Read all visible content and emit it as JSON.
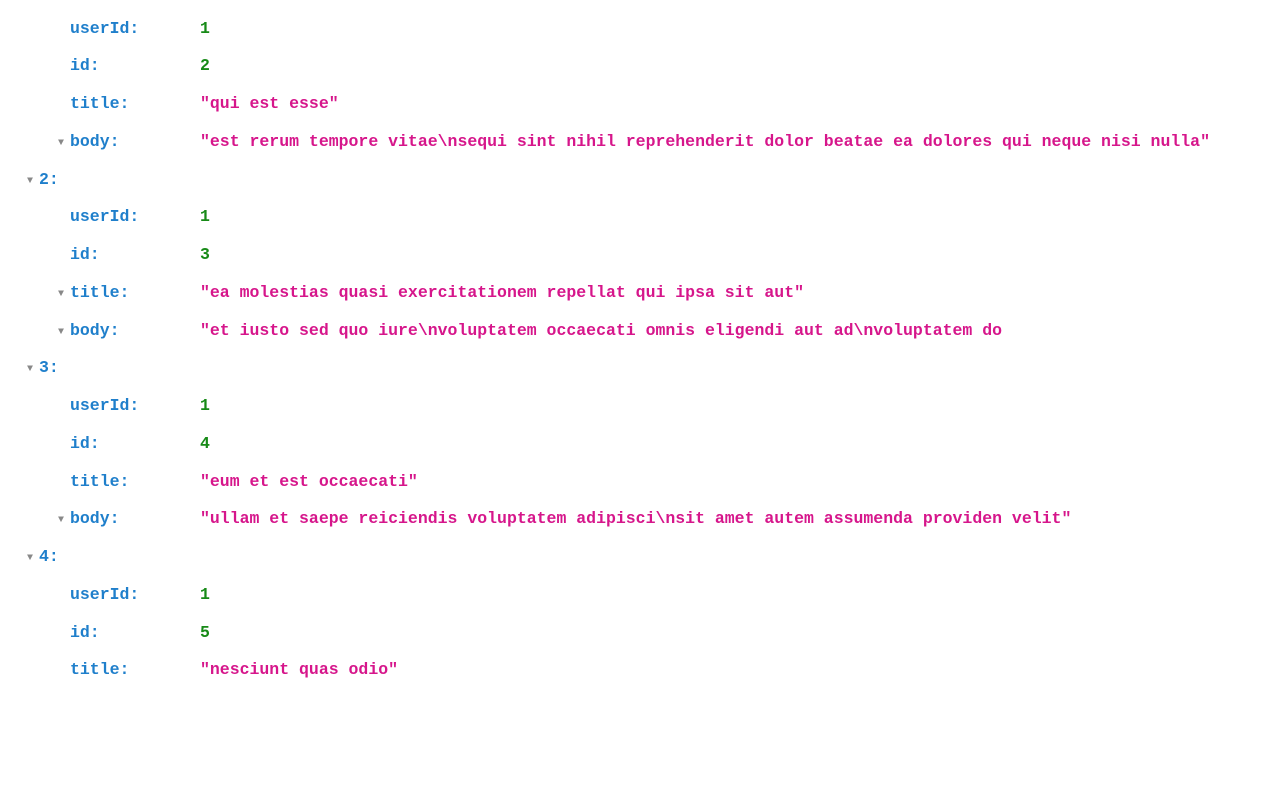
{
  "tree": [
    {
      "type": "prop",
      "key": "userId",
      "value": "1",
      "valType": "num",
      "toggle": false,
      "wrap": false
    },
    {
      "type": "prop",
      "key": "id",
      "value": "2",
      "valType": "num",
      "toggle": false,
      "wrap": false
    },
    {
      "type": "prop",
      "key": "title",
      "value": "\"qui est esse\"",
      "valType": "str",
      "toggle": false,
      "wrap": false
    },
    {
      "type": "prop",
      "key": "body",
      "value": "\"est rerum tempore vitae\\nsequi sint nihil reprehenderit dolor beatae ea dolores qui neque nisi nulla\"",
      "valType": "str",
      "toggle": true,
      "wrap": true
    },
    {
      "type": "group",
      "key": "2",
      "toggle": true
    },
    {
      "type": "prop",
      "key": "userId",
      "value": "1",
      "valType": "num",
      "toggle": false,
      "wrap": false
    },
    {
      "type": "prop",
      "key": "id",
      "value": "3",
      "valType": "num",
      "toggle": false,
      "wrap": false
    },
    {
      "type": "prop",
      "key": "title",
      "value": "\"ea molestias quasi exercitationem repellat qui ipsa sit aut\"",
      "valType": "str",
      "toggle": true,
      "wrap": false
    },
    {
      "type": "prop",
      "key": "body",
      "value": "\"et iusto sed quo iure\\nvoluptatem occaecati omnis eligendi aut ad\\nvoluptatem do",
      "valType": "str",
      "toggle": true,
      "wrap": false
    },
    {
      "type": "group",
      "key": "3",
      "toggle": true
    },
    {
      "type": "prop",
      "key": "userId",
      "value": "1",
      "valType": "num",
      "toggle": false,
      "wrap": false
    },
    {
      "type": "prop",
      "key": "id",
      "value": "4",
      "valType": "num",
      "toggle": false,
      "wrap": false
    },
    {
      "type": "prop",
      "key": "title",
      "value": "\"eum et est occaecati\"",
      "valType": "str",
      "toggle": false,
      "wrap": false
    },
    {
      "type": "prop",
      "key": "body",
      "value": "\"ullam et saepe reiciendis voluptatem adipisci\\nsit amet autem assumenda providen velit\"",
      "valType": "str",
      "toggle": true,
      "wrap": true
    },
    {
      "type": "group",
      "key": "4",
      "toggle": true
    },
    {
      "type": "prop",
      "key": "userId",
      "value": "1",
      "valType": "num",
      "toggle": false,
      "wrap": false
    },
    {
      "type": "prop",
      "key": "id",
      "value": "5",
      "valType": "num",
      "toggle": false,
      "wrap": false
    },
    {
      "type": "prop",
      "key": "title",
      "value": "\"nesciunt quas odio\"",
      "valType": "str",
      "toggle": false,
      "wrap": false
    }
  ]
}
